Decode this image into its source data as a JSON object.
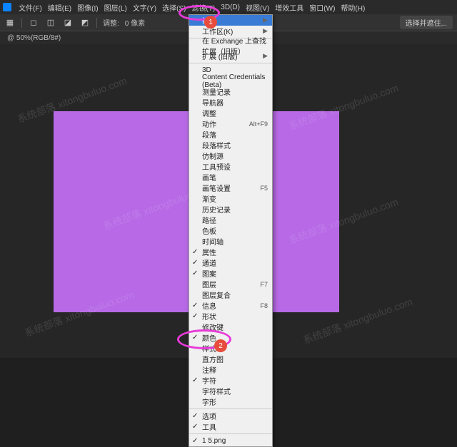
{
  "menubar": {
    "items": [
      "文件(F)",
      "编辑(E)",
      "图像(I)",
      "图层(L)",
      "文字(Y)",
      "选择(S)",
      "滤镜(T)",
      "3D(D)",
      "视图(V)",
      "增效工具",
      "窗口(W)",
      "帮助(H)"
    ]
  },
  "toolbar": {
    "resize_label": "调整:",
    "pixels": "0 像素",
    "select_keep": "选择并遮住..."
  },
  "tab": {
    "label": "@ 50%(RGB/8#)"
  },
  "dropdown": {
    "items": [
      {
        "label": "排列",
        "arrow": true,
        "hi": true
      },
      {
        "label": "工作区(K)",
        "arrow": true
      },
      {
        "sep": true
      },
      {
        "label": "在 Exchange 上查找扩展（旧版）"
      },
      {
        "label": "扩展 (旧版)",
        "arrow": true
      },
      {
        "sep": true
      },
      {
        "label": "3D"
      },
      {
        "label": "Content Credentials (Beta)"
      },
      {
        "label": "测量记录"
      },
      {
        "label": "导航器"
      },
      {
        "label": "调整"
      },
      {
        "label": "动作",
        "sc": "Alt+F9"
      },
      {
        "label": "段落"
      },
      {
        "label": "段落样式"
      },
      {
        "label": "仿制源"
      },
      {
        "label": "工具预设"
      },
      {
        "label": "画笔"
      },
      {
        "label": "画笔设置",
        "sc": "F5"
      },
      {
        "label": "渐变"
      },
      {
        "label": "历史记录"
      },
      {
        "label": "路径"
      },
      {
        "label": "色板"
      },
      {
        "label": "时间轴"
      },
      {
        "label": "属性",
        "chk": true
      },
      {
        "label": "通道",
        "chk": true
      },
      {
        "label": "图案",
        "chk": true
      },
      {
        "label": "图层",
        "sc": "F7"
      },
      {
        "label": "图层复合"
      },
      {
        "label": "信息",
        "sc": "F8",
        "chk": true
      },
      {
        "label": "形状",
        "chk": true
      },
      {
        "label": "修改键"
      },
      {
        "label": "颜色",
        "chk": true
      },
      {
        "label": "样式"
      },
      {
        "label": "直方图"
      },
      {
        "label": "注释"
      },
      {
        "label": "字符",
        "chk": true
      },
      {
        "label": "字符样式"
      },
      {
        "label": "字形"
      },
      {
        "sep": true
      },
      {
        "label": "选项",
        "chk": true
      },
      {
        "label": "工具",
        "chk": true
      },
      {
        "sep": true
      },
      {
        "label": "1 5.png",
        "chk": true
      }
    ]
  },
  "markers": {
    "one": "1",
    "two": "2"
  },
  "watermark": "系统部落 xitongbuluo.com"
}
